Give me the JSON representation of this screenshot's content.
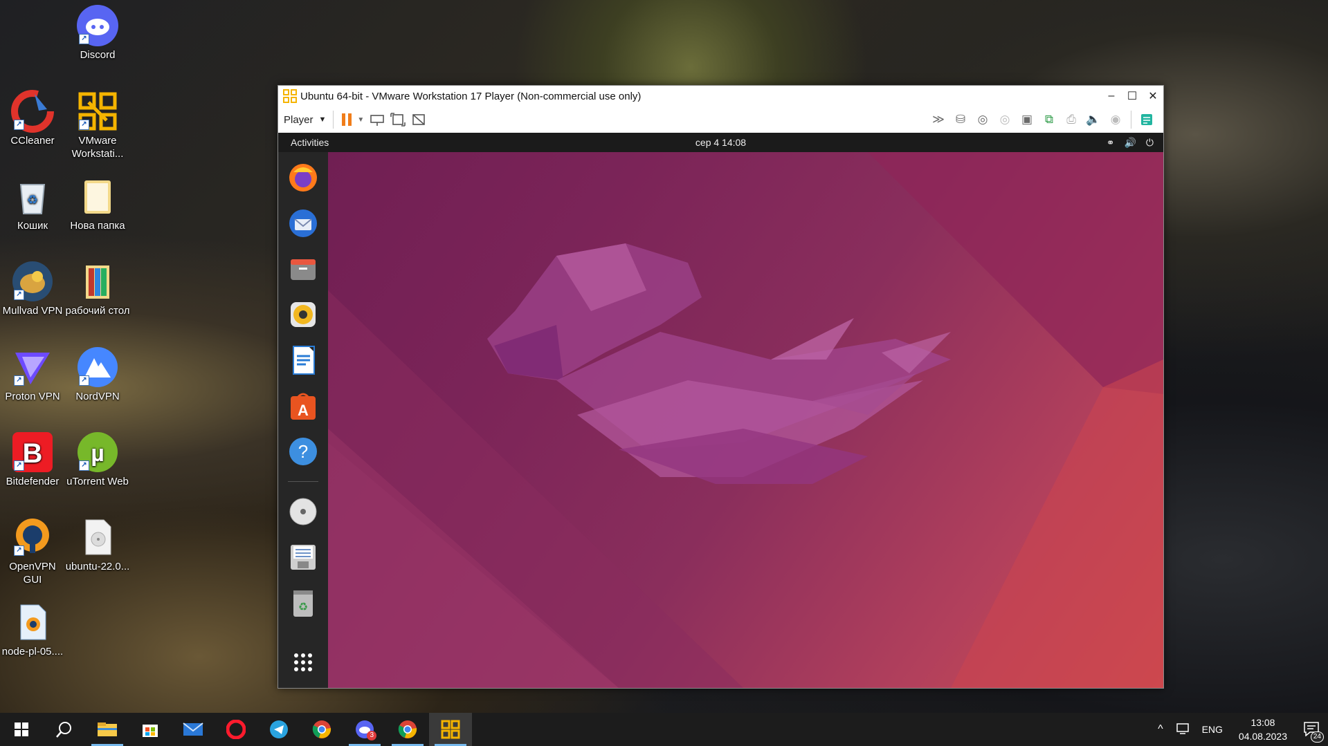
{
  "desktop": {
    "icons": [
      {
        "label": "Discord"
      },
      {
        "label": "CCleaner"
      },
      {
        "label": "VMware Workstati..."
      },
      {
        "label": "Кошик"
      },
      {
        "label": "Нова папка"
      },
      {
        "label": "Mullvad VPN"
      },
      {
        "label": "рабочий стол"
      },
      {
        "label": "Proton VPN"
      },
      {
        "label": "NordVPN"
      },
      {
        "label": "Bitdefender"
      },
      {
        "label": "uTorrent Web"
      },
      {
        "label": "OpenVPN GUI"
      },
      {
        "label": "ubuntu-22.0..."
      },
      {
        "label": "node-pl-05...."
      }
    ]
  },
  "vmware": {
    "title": "Ubuntu 64-bit - VMware Workstation 17 Player (Non-commercial use only)",
    "player_menu": "Player",
    "controls": {
      "minimize": "–",
      "maximize": "☐",
      "close": "✕"
    },
    "accent_color": "#f07d1a"
  },
  "ubuntu": {
    "activities": "Activities",
    "clock": "сер 4  14:08",
    "dock_apps": [
      "firefox-icon",
      "thunderbird-icon",
      "files-icon",
      "rhythmbox-icon",
      "writer-icon",
      "software-icon",
      "help-icon",
      "dvd-icon",
      "floppy-icon",
      "trash-icon",
      "app-grid-icon"
    ]
  },
  "taskbar": {
    "lang": "ENG",
    "time": "13:08",
    "date": "04.08.2023",
    "notifications": "24",
    "discord_badge": "3"
  }
}
